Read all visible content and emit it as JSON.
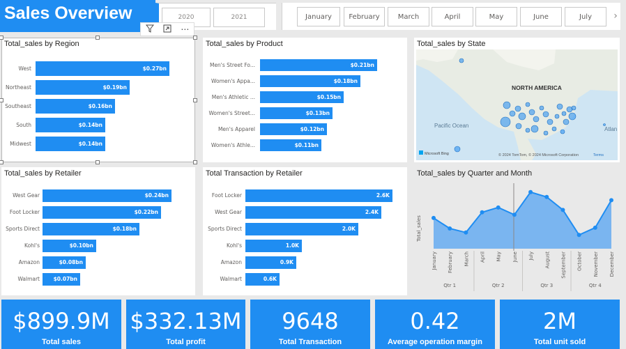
{
  "header": {
    "title": "Sales Overview",
    "years": [
      "2020",
      "2021"
    ],
    "months": [
      "January",
      "February",
      "March",
      "April",
      "May",
      "June",
      "July"
    ],
    "next_icon": "chevron-right-icon"
  },
  "visual_header": {
    "icons": [
      "filter-icon",
      "focus-mode-icon",
      "more-options-icon"
    ],
    "more_text": "⋯"
  },
  "charts": {
    "region": {
      "title": "Total_sales by Region",
      "items": [
        {
          "label": "West",
          "value": 0.27,
          "text": "$0.27bn"
        },
        {
          "label": "Northeast",
          "value": 0.19,
          "text": "$0.19bn"
        },
        {
          "label": "Southeast",
          "value": 0.16,
          "text": "$0.16bn"
        },
        {
          "label": "South",
          "value": 0.14,
          "text": "$0.14bn"
        },
        {
          "label": "Midwest",
          "value": 0.14,
          "text": "$0.14bn"
        }
      ]
    },
    "product": {
      "title": "Total_sales by Product",
      "items": [
        {
          "label": "Men's Street Fo...",
          "value": 0.21,
          "text": "$0.21bn"
        },
        {
          "label": "Women's Appa...",
          "value": 0.18,
          "text": "$0.18bn"
        },
        {
          "label": "Men's Athletic ...",
          "value": 0.15,
          "text": "$0.15bn"
        },
        {
          "label": "Women's Street...",
          "value": 0.13,
          "text": "$0.13bn"
        },
        {
          "label": "Men's Apparel",
          "value": 0.12,
          "text": "$0.12bn"
        },
        {
          "label": "Women's Athle...",
          "value": 0.11,
          "text": "$0.11bn"
        }
      ]
    },
    "state": {
      "title": "Total_sales by State",
      "map_labels": {
        "continent": "NORTH AMERICA",
        "pacific": "Pacific Ocean",
        "atlantic": "Atlan Oce"
      },
      "attribution": "© 2024 TomTom, © 2024 Microsoft Corporation",
      "terms": "Terms",
      "bing": "Microsoft Bing"
    },
    "retailer_sales": {
      "title": "Total_sales by Retailer",
      "items": [
        {
          "label": "West Gear",
          "value": 0.24,
          "text": "$0.24bn"
        },
        {
          "label": "Foot Locker",
          "value": 0.22,
          "text": "$0.22bn"
        },
        {
          "label": "Sports Direct",
          "value": 0.18,
          "text": "$0.18bn"
        },
        {
          "label": "Kohl's",
          "value": 0.1,
          "text": "$0.10bn"
        },
        {
          "label": "Amazon",
          "value": 0.08,
          "text": "$0.08bn"
        },
        {
          "label": "Walmart",
          "value": 0.07,
          "text": "$0.07bn"
        }
      ]
    },
    "retailer_tx": {
      "title": "Total Transaction by Retailer",
      "items": [
        {
          "label": "Foot Locker",
          "value": 2.6,
          "text": "2.6K"
        },
        {
          "label": "West Gear",
          "value": 2.4,
          "text": "2.4K"
        },
        {
          "label": "Sports Direct",
          "value": 2.0,
          "text": "2.0K"
        },
        {
          "label": "Kohl's",
          "value": 1.0,
          "text": "1.0K"
        },
        {
          "label": "Amazon",
          "value": 0.9,
          "text": "0.9K"
        },
        {
          "label": "Walmart",
          "value": 0.6,
          "text": "0.6K"
        }
      ]
    },
    "quarter_month": {
      "title": "Total_sales by Quarter and Month",
      "ylabel": "Total_sales",
      "months": [
        "January",
        "February",
        "March",
        "April",
        "May",
        "June",
        "July",
        "August",
        "September",
        "October",
        "November",
        "December"
      ],
      "quarters": [
        "Qtr 1",
        "Qtr 2",
        "Qtr 3",
        "Qtr 4"
      ]
    }
  },
  "chart_data": [
    {
      "type": "bar",
      "title": "Total_sales by Region",
      "categories": [
        "West",
        "Northeast",
        "Southeast",
        "South",
        "Midwest"
      ],
      "values": [
        0.27,
        0.19,
        0.16,
        0.14,
        0.14
      ]
    },
    {
      "type": "bar",
      "title": "Total_sales by Product",
      "categories": [
        "Men's Street Fo...",
        "Women's Appa...",
        "Men's Athletic ...",
        "Women's Street...",
        "Men's Apparel",
        "Women's Athle..."
      ],
      "values": [
        0.21,
        0.18,
        0.15,
        0.13,
        0.12,
        0.11
      ]
    },
    {
      "type": "bar",
      "title": "Total_sales by Retailer",
      "categories": [
        "West Gear",
        "Foot Locker",
        "Sports Direct",
        "Kohl's",
        "Amazon",
        "Walmart"
      ],
      "values": [
        0.24,
        0.22,
        0.18,
        0.1,
        0.08,
        0.07
      ]
    },
    {
      "type": "bar",
      "title": "Total Transaction by Retailer",
      "categories": [
        "Foot Locker",
        "West Gear",
        "Sports Direct",
        "Kohl's",
        "Amazon",
        "Walmart"
      ],
      "values": [
        2.6,
        2.4,
        2.0,
        1.0,
        0.9,
        0.6
      ]
    },
    {
      "type": "area",
      "title": "Total_sales by Quarter and Month",
      "ylabel": "Total_sales",
      "categories": [
        "January",
        "February",
        "March",
        "April",
        "May",
        "June",
        "July",
        "August",
        "September",
        "October",
        "November",
        "December"
      ],
      "values": [
        88,
        75,
        70,
        95,
        101,
        92,
        120,
        114,
        98,
        67,
        76,
        110
      ],
      "grid": false
    }
  ],
  "kpis": [
    {
      "value": "$899.9M",
      "label": "Total sales"
    },
    {
      "value": "$332.13M",
      "label": "Total profit"
    },
    {
      "value": "9648",
      "label": "Total Transaction"
    },
    {
      "value": "0.42",
      "label": "Average operation margin"
    },
    {
      "value": "2M",
      "label": "Total unit sold"
    }
  ],
  "colors": {
    "accent": "#1f8df2",
    "area_fill": "#7ab5f0",
    "line": "#1f8df2"
  }
}
